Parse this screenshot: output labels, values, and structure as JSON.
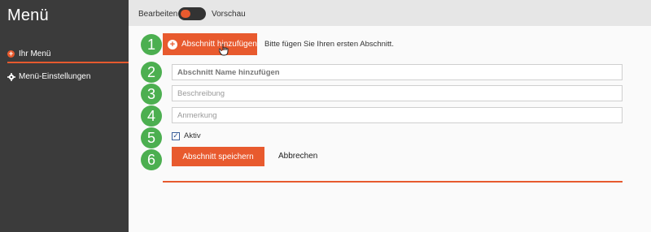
{
  "sidebar": {
    "title": "Menü",
    "items": [
      {
        "label": "Ihr Menü",
        "icon": "plus-circle-icon"
      },
      {
        "label": "Menü-Einstellungen",
        "icon": "gear-icon"
      }
    ]
  },
  "topbar": {
    "left_label": "Bearbeiten",
    "right_label": "Vorschau",
    "toggle_state": "Bearbeiten"
  },
  "main": {
    "add_button": {
      "label": "Abschnitt hinzufügen",
      "icon": "plus-circle-icon"
    },
    "hint": "Bitte fügen Sie Ihren ersten Abschnitt.",
    "fields": {
      "name_placeholder": "Abschnitt Name hinzufügen",
      "description_placeholder": "Beschreibung",
      "note_placeholder": "Anmerkung"
    },
    "active_label": "Aktiv",
    "active_checked": true,
    "save_label": "Abschnitt speichern",
    "cancel_label": "Abbrechen",
    "steps": [
      "1",
      "2",
      "3",
      "4",
      "5",
      "6"
    ]
  },
  "colors": {
    "accent": "#e85a2e",
    "sidebar_bg": "#3b3b3b",
    "step_badge": "#4caf50"
  }
}
